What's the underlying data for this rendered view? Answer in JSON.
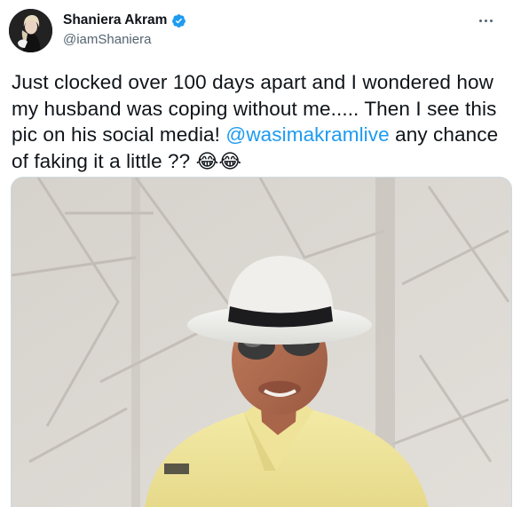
{
  "author": {
    "name": "Shaniera Akram",
    "handle": "@iamShaniera",
    "verified": true
  },
  "tweet": {
    "text_before": "Just clocked over 100 days apart and I wondered how my husband was coping without me..... Then I see this pic on his social media! ",
    "mention": "@wasimakramlive",
    "text_after": " any chance of faking it a little ?? ",
    "emojis": "😂😂"
  },
  "colors": {
    "link": "#1d9bf0",
    "verified": "#1d9bf0",
    "handle": "#536471",
    "text": "#0f1419"
  },
  "icons": {
    "verified": "verified-badge-icon",
    "more": "more-options-icon"
  }
}
